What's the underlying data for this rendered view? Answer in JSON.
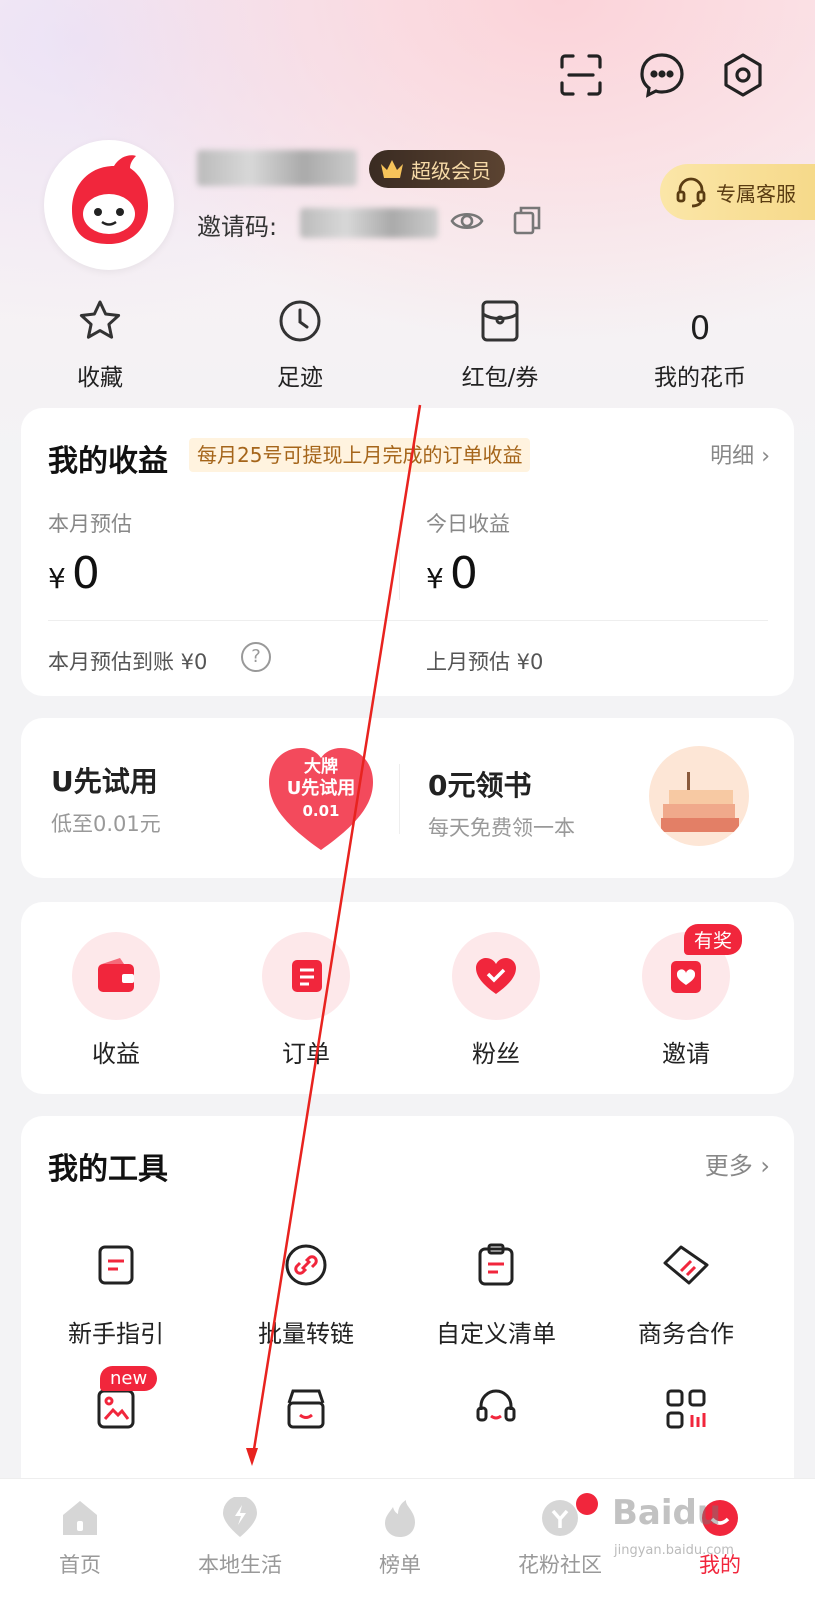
{
  "header": {
    "icons": [
      "scan-icon",
      "message-icon",
      "settings-icon"
    ]
  },
  "profile": {
    "vip_label": "超级会员",
    "invite_label": "邀请码:",
    "service_label": "专属客服"
  },
  "quick": [
    {
      "label": "收藏",
      "icon": "star-icon"
    },
    {
      "label": "足迹",
      "icon": "clock-icon"
    },
    {
      "label": "红包/券",
      "icon": "coupon-icon"
    },
    {
      "label": "我的花币",
      "value": "0"
    }
  ],
  "earnings": {
    "title": "我的收益",
    "note": "每月25号可提现上月完成的订单收益",
    "detail": "明细",
    "month_label": "本月预估",
    "month_value": "0",
    "today_label": "今日收益",
    "today_value": "0",
    "currency": "¥",
    "month_arrive": "本月预估到账 ¥0",
    "last_month": "上月预估 ¥0"
  },
  "promos": [
    {
      "title": "U先试用",
      "sub": "低至0.01元",
      "art_top": "大牌",
      "art_mid": "U先试用",
      "art_low": "0.01"
    },
    {
      "title": "0元领书",
      "sub": "每天免费领一本"
    }
  ],
  "actions": [
    {
      "label": "收益",
      "icon": "wallet-icon"
    },
    {
      "label": "订单",
      "icon": "order-icon"
    },
    {
      "label": "粉丝",
      "icon": "heart-icon"
    },
    {
      "label": "邀请",
      "icon": "invite-icon",
      "badge": "有奖"
    }
  ],
  "tools": {
    "title": "我的工具",
    "more": "更多",
    "items": [
      {
        "label": "新手指引",
        "icon": "guide-icon"
      },
      {
        "label": "批量转链",
        "icon": "link-icon"
      },
      {
        "label": "自定义清单",
        "icon": "clipboard-icon"
      },
      {
        "label": "商务合作",
        "icon": "handshake-icon"
      },
      {
        "label": "",
        "icon": "image-icon",
        "badge": "new"
      },
      {
        "label": "",
        "icon": "store-icon"
      },
      {
        "label": "",
        "icon": "headset-icon"
      },
      {
        "label": "",
        "icon": "apps-icon"
      }
    ]
  },
  "tabbar": [
    {
      "label": "首页"
    },
    {
      "label": "本地生活"
    },
    {
      "label": "榜单"
    },
    {
      "label": "花粉社区"
    },
    {
      "label": "我的",
      "active": true
    }
  ],
  "watermark": {
    "brand": "Bai",
    "brand2": "du",
    "sub": "jingyan.baidu.com"
  },
  "colors": {
    "accent": "#f1263c",
    "vip_bg": "#3a2b22",
    "service_bg": "#f6d989"
  }
}
